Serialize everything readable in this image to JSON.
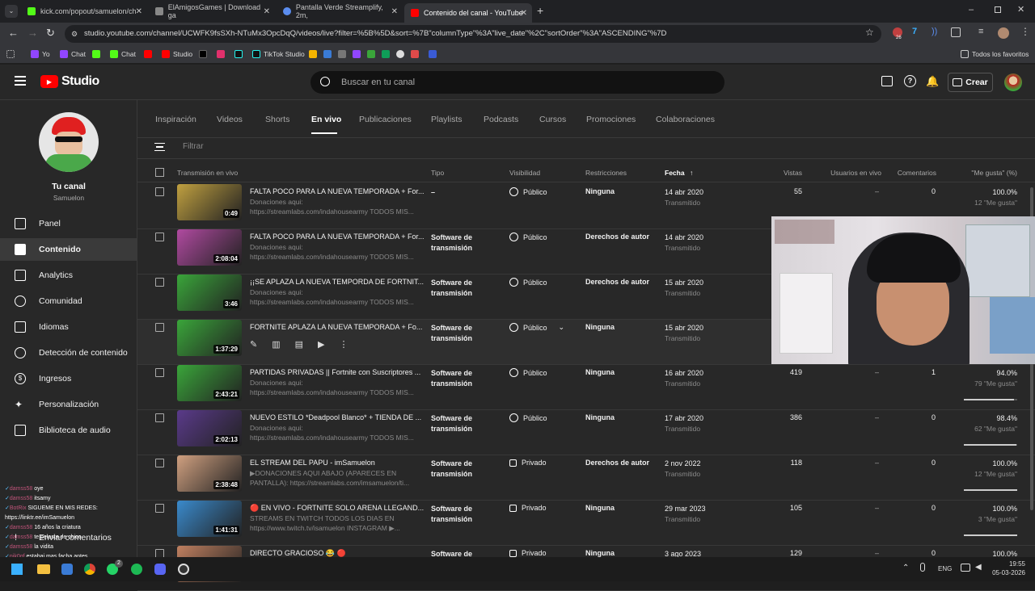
{
  "browser": {
    "tabs": [
      {
        "title": "kick.com/popout/samuelon/ch",
        "color": "#53fc18"
      },
      {
        "title": "ElAmigosGames | Download ga",
        "color": "#888888"
      },
      {
        "title": "Pantalla Verde Streamplify, 2m,",
        "color": "#5b8def"
      },
      {
        "title": "Contenido del canal - YouTube",
        "color": "#ff0000"
      }
    ],
    "url": "studio.youtube.com/channel/UCWFK9fsSXh-NTuMx3OpcDqQ/videos/live?filter=%5B%5D&sort=%7B\"columnType\"%3A\"live_date\"%2C\"sortOrder\"%3A\"ASCENDING\"%7D",
    "extension_badge": "26",
    "bookmarks": [
      "Yo",
      "Chat",
      "Chat",
      "Studio",
      "TikTok Studio"
    ],
    "all_bookmarks": "Todos los favoritos"
  },
  "header": {
    "logo_text": "Studio",
    "search_placeholder": "Buscar en tu canal",
    "create_label": "Crear"
  },
  "sidebar": {
    "channel_label": "Tu canal",
    "channel_name": "Samuelon",
    "items": [
      {
        "label": "Panel",
        "icon": "dashboard-icon"
      },
      {
        "label": "Contenido",
        "icon": "content-icon"
      },
      {
        "label": "Analytics",
        "icon": "analytics-icon"
      },
      {
        "label": "Comunidad",
        "icon": "community-icon"
      },
      {
        "label": "Idiomas",
        "icon": "subtitles-icon"
      },
      {
        "label": "Detección de contenido",
        "icon": "copyright-icon"
      },
      {
        "label": "Ingresos",
        "icon": "dollar-icon"
      },
      {
        "label": "Personalización",
        "icon": "magic-wand-icon"
      },
      {
        "label": "Biblioteca de audio",
        "icon": "audio-library-icon"
      }
    ],
    "feedback_label": "Enviar comentarios"
  },
  "content": {
    "tabs": [
      "Inspiración",
      "Videos",
      "Shorts",
      "En vivo",
      "Publicaciones",
      "Playlists",
      "Podcasts",
      "Cursos",
      "Promociones",
      "Colaboraciones"
    ],
    "filter_placeholder": "Filtrar",
    "columns": {
      "transmision": "Transmisión en vivo",
      "tipo": "Tipo",
      "visibilidad": "Visibilidad",
      "restricciones": "Restricciones",
      "fecha": "Fecha",
      "vistas": "Vistas",
      "usuarios": "Usuarios en vivo",
      "comentarios": "Comentarios",
      "megusta": "\"Me gusta\" (%)"
    },
    "rows": [
      {
        "duration": "0:49",
        "title": "FALTA POCO PARA LA NUEVA TEMPORADA + For...",
        "desc1": "Donaciones aqui:",
        "desc2": "https://streamlabs.com/indahousearmy TODOS MIS...",
        "tipo1": "–",
        "tipo2": "",
        "vis": "Público",
        "res": "Ninguna",
        "fecha": "14 abr 2020",
        "fecha_sub": "Transmitido",
        "vistas": "55",
        "usuarios": "–",
        "comentarios": "0",
        "like": "100.0%",
        "like_sub": "12 \"Me gusta\"",
        "like_frac": 1.0,
        "thumb": "#c0a040"
      },
      {
        "duration": "2:08:04",
        "title": "FALTA POCO PARA LA NUEVA TEMPORADA + For...",
        "desc1": "Donaciones aqui:",
        "desc2": "https://streamlabs.com/indahousearmy TODOS MIS...",
        "tipo1": "Software de",
        "tipo2": "transmisión",
        "vis": "Público",
        "res": "Derechos de autor",
        "fecha": "14 abr 2020",
        "fecha_sub": "Transmitido",
        "vistas": "",
        "usuarios": "",
        "comentarios": "",
        "like": "",
        "like_sub": "",
        "like_frac": null,
        "thumb": "#b04aa0"
      },
      {
        "duration": "3:46",
        "title": "¡¡SE APLAZA LA NUEVA TEMPORDA DE FORTNIT...",
        "desc1": "Donaciones aqui:",
        "desc2": "https://streamlabs.com/indahousearmy TODOS MIS...",
        "tipo1": "Software de",
        "tipo2": "transmisión",
        "vis": "Público",
        "res": "Derechos de autor",
        "fecha": "15 abr 2020",
        "fecha_sub": "Transmitido",
        "vistas": "",
        "usuarios": "",
        "comentarios": "",
        "like": "",
        "like_sub": "",
        "like_frac": null,
        "thumb": "#3aa53a"
      },
      {
        "duration": "1:37:29",
        "title": "FORTNITE APLAZA LA NUEVA TEMPORADA + Fo...",
        "desc1": "",
        "desc2": "",
        "tipo1": "Software de",
        "tipo2": "transmisión",
        "vis": "Público",
        "res": "Ninguna",
        "fecha": "15 abr 2020",
        "fecha_sub": "Transmitido",
        "vistas": "",
        "usuarios": "",
        "comentarios": "",
        "like": "",
        "like_sub": "",
        "like_frac": null,
        "thumb": "#3aa53a",
        "hover": true
      },
      {
        "duration": "2:43:21",
        "title": "PARTIDAS PRIVADAS || Fortnite con Suscriptores ...",
        "desc1": "Donaciones aqui:",
        "desc2": "https://streamlabs.com/indahousearmy TODOS MIS...",
        "tipo1": "Software de",
        "tipo2": "transmisión",
        "vis": "Público",
        "res": "Ninguna",
        "fecha": "16 abr 2020",
        "fecha_sub": "Transmitido",
        "vistas": "419",
        "usuarios": "–",
        "comentarios": "1",
        "like": "94.0%",
        "like_sub": "79 \"Me gusta\"",
        "like_frac": 0.94,
        "thumb": "#3aa53a"
      },
      {
        "duration": "2:02:13",
        "title": "NUEVO ESTILO *Deadpool Blanco* + TIENDA DE ...",
        "desc1": "Donaciones aqui:",
        "desc2": "https://streamlabs.com/indahousearmy TODOS MIS...",
        "tipo1": "Software de",
        "tipo2": "transmisión",
        "vis": "Público",
        "res": "Ninguna",
        "fecha": "17 abr 2020",
        "fecha_sub": "Transmitido",
        "vistas": "386",
        "usuarios": "–",
        "comentarios": "0",
        "like": "98.4%",
        "like_sub": "62 \"Me gusta\"",
        "like_frac": 0.984,
        "thumb": "#5a3a8a"
      },
      {
        "duration": "2:38:48",
        "title": "EL STREAM DEL PAPU - imSamuelon",
        "desc1": "▶DONACIONES AQUI ABAJO (APARECES EN",
        "desc2": "PANTALLA): https://streamlabs.com/imsamuelon/ti...",
        "tipo1": "Software de",
        "tipo2": "transmisión",
        "vis": "Privado",
        "res": "Derechos de autor",
        "fecha": "2 nov 2022",
        "fecha_sub": "Transmitido",
        "vistas": "118",
        "usuarios": "–",
        "comentarios": "0",
        "like": "100.0%",
        "like_sub": "12 \"Me gusta\"",
        "like_frac": 1.0,
        "thumb": "#d0a080"
      },
      {
        "duration": "1:41:31",
        "title": "🔴 EN VIVO - FORTNITE SOLO ARENA LLEGAND...",
        "desc1": "STREAMS EN TWITCH TODOS LOS DIAS EN",
        "desc2": "https://www.twitch.tv/isamuelon INSTAGRAM ▶...",
        "tipo1": "Software de",
        "tipo2": "transmisión",
        "vis": "Privado",
        "res": "Ninguna",
        "fecha": "29 mar 2023",
        "fecha_sub": "Transmitido",
        "vistas": "105",
        "usuarios": "–",
        "comentarios": "0",
        "like": "100.0%",
        "like_sub": "3 \"Me gusta\"",
        "like_frac": 1.0,
        "thumb": "#3a8acc"
      },
      {
        "duration": "",
        "title": "DIRECTO GRACIOSO 😂 🔴",
        "desc1": "",
        "desc2": "",
        "tipo1": "Software de",
        "tipo2": "",
        "vis": "Privado",
        "res": "Ninguna",
        "fecha": "3 ago 2023",
        "fecha_sub": "",
        "vistas": "129",
        "usuarios": "–",
        "comentarios": "0",
        "like": "100.0%",
        "like_sub": "",
        "like_frac": null,
        "thumb": "#c08060"
      }
    ]
  },
  "chat": [
    {
      "user": "damss58",
      "text": "oye"
    },
    {
      "user": "damss58",
      "text": "itsamy"
    },
    {
      "user": "BotRix",
      "text": "SIGUEME EN MIS REDES: https://linktr.ee/imSamuelon"
    },
    {
      "user": "damss58",
      "text": "16 años la criatura"
    },
    {
      "user": "damss58",
      "text": "te pelaste de chico"
    },
    {
      "user": "damss58",
      "text": "la vidita"
    },
    {
      "user": "nik0qf",
      "text": "estabai mas facha antes"
    },
    {
      "user": "damss58",
      "text": "como te deja la pasta"
    }
  ],
  "taskbar": {
    "lang": "ENG",
    "time": "19:55",
    "date": "05-03-2026",
    "whatsapp_badge": "2"
  }
}
